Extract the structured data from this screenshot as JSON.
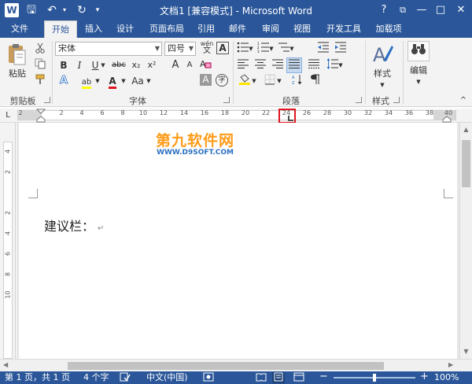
{
  "titlebar": {
    "title": "文档1 [兼容模式] - Microsoft Word",
    "app_icon": "W",
    "qat": {
      "save": "🖫",
      "undo": "↶",
      "undo_arrow": "▾",
      "redo": "↻",
      "customize": "▾"
    },
    "help": "?",
    "window": {
      "restore": "⧉",
      "minimize": "—",
      "maximize": "□",
      "close": "✕"
    }
  },
  "tabs": [
    {
      "label": "文件"
    },
    {
      "label": "开始"
    },
    {
      "label": "插入"
    },
    {
      "label": "设计"
    },
    {
      "label": "页面布局"
    },
    {
      "label": "引用"
    },
    {
      "label": "邮件"
    },
    {
      "label": "审阅"
    },
    {
      "label": "视图"
    },
    {
      "label": "开发工具"
    },
    {
      "label": "加载项"
    }
  ],
  "ribbon": {
    "clipboard": {
      "label": "剪贴板",
      "paste": "粘贴"
    },
    "font": {
      "label": "字体",
      "font_name": "宋体",
      "font_size": "四号",
      "wen": "wén",
      "wen_char": "文",
      "bold": "B",
      "italic": "I",
      "underline": "U",
      "strike": "abc",
      "subscript": "x₂",
      "superscript": "x²",
      "highlight": "ab",
      "font_color": "A",
      "change_case": "Aa",
      "grow": "A",
      "shrink": "A",
      "shade": "A",
      "encircle": "字"
    },
    "paragraph": {
      "label": "段落"
    },
    "styles": {
      "label": "样式",
      "button": "样式"
    },
    "editing": {
      "button": "编辑"
    },
    "collapse": "^"
  },
  "ruler": {
    "ticks": [
      "2",
      "2",
      "4",
      "6",
      "8",
      "10",
      "12",
      "14",
      "16",
      "18",
      "20",
      "22",
      "24",
      "26",
      "28",
      "30",
      "32",
      "34",
      "36",
      "38",
      "40"
    ],
    "tab_selector": "L",
    "highlighted_tick": "24"
  },
  "vruler": {
    "ticks": [
      "4",
      "2",
      "2",
      "4",
      "6",
      "8",
      "10"
    ]
  },
  "document": {
    "text": "建议栏：",
    "para_mark": "↵",
    "watermark_top": "第九软件网",
    "watermark_bottom": "WWW.D9SOFT.COM"
  },
  "statusbar": {
    "page": "第 1 页，共 1 页",
    "words": "4 个字",
    "language": "中文(中国)",
    "zoom_minus": "−",
    "zoom_plus": "+",
    "zoom": "100%"
  },
  "colors": {
    "accent": "#2b579a",
    "highlight_border": "#e0141e",
    "watermark_orange": "#ff9c1a",
    "watermark_blue": "#2b6fc2"
  }
}
